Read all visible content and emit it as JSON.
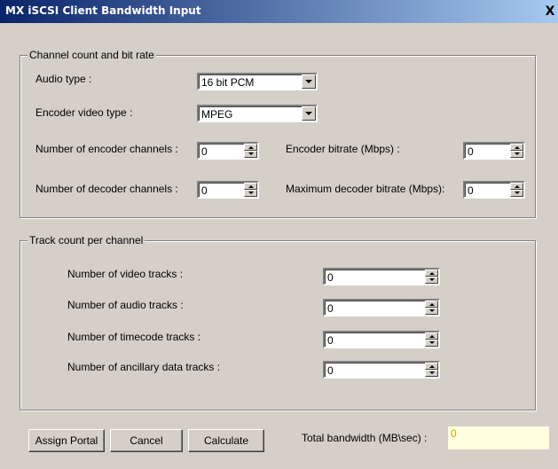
{
  "window": {
    "title": "MX iSCSI Client Bandwidth Input",
    "close_label": "X"
  },
  "channel_group": {
    "legend": "Channel count and bit rate",
    "audio_type": {
      "label": "Audio type :",
      "value": "16 bit PCM"
    },
    "encoder_video_type": {
      "label": "Encoder video type :",
      "value": "MPEG"
    },
    "encoder_channels": {
      "label": "Number of encoder channels :",
      "value": "0"
    },
    "decoder_channels": {
      "label": "Number of decoder channels :",
      "value": "0"
    },
    "encoder_bitrate": {
      "label": "Encoder bitrate (Mbps) :",
      "value": "0"
    },
    "max_decoder_bitrate": {
      "label": "Maximum decoder bitrate (Mbps):",
      "value": "0"
    }
  },
  "track_group": {
    "legend": "Track count per channel",
    "video_tracks": {
      "label": "Number of video tracks :",
      "value": "0"
    },
    "audio_tracks": {
      "label": "Number of audio tracks :",
      "value": "0"
    },
    "timecode_tracks": {
      "label": "Number of timecode tracks :",
      "value": "0"
    },
    "ancillary_tracks": {
      "label": "Number of ancillary data tracks :",
      "value": "0"
    }
  },
  "footer": {
    "assign_portal_label": "Assign Portal",
    "cancel_label": "Cancel",
    "calculate_label": "Calculate",
    "total_bandwidth_label": "Total bandwidth (MB\\sec) :",
    "total_bandwidth_value": "0"
  },
  "colors": {
    "title_bar_start": "#0a246a",
    "title_bar_end": "#a6caf0",
    "dialog_background": "#d4d0c8",
    "output_background": "#ffffe1",
    "output_text": "#c8a000"
  }
}
